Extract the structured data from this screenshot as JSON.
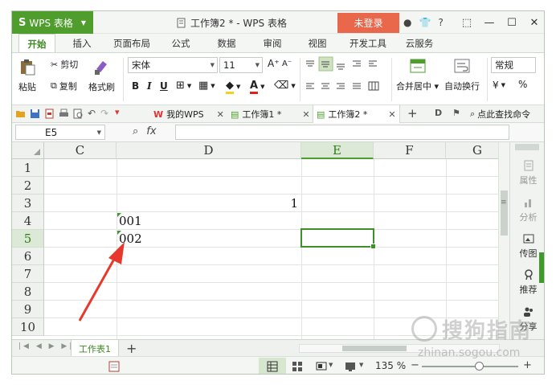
{
  "titlebar": {
    "app_name": "WPS 表格",
    "doc_title": "工作簿2 * - WPS 表格",
    "login_label": "未登录",
    "help_label": "?"
  },
  "ribbon_tabs": [
    "开始",
    "插入",
    "页面布局",
    "公式",
    "数据",
    "审阅",
    "视图",
    "开发工具",
    "云服务"
  ],
  "ribbon": {
    "paste": "粘贴",
    "cut": "剪切",
    "copy": "复制",
    "format_painter": "格式刷",
    "font_name": "宋体",
    "font_size": "11",
    "merge_center": "合并居中",
    "wrap_text": "自动换行",
    "number_format": "常规",
    "percent": "%"
  },
  "quickbar": {
    "my_wps": "我的WPS",
    "doc_tab_1": "工作簿1 *",
    "doc_tab_2": "工作簿2 *",
    "find_command": "点此查找命令"
  },
  "formula_bar": {
    "cell_ref": "E5",
    "formula_value": ""
  },
  "grid": {
    "columns": [
      "C",
      "D",
      "E",
      "F",
      "G"
    ],
    "selected_column": "E",
    "rows": [
      "1",
      "2",
      "3",
      "4",
      "5",
      "6",
      "7",
      "8",
      "9",
      "10"
    ],
    "selected_row": "5",
    "cells": {
      "D3": "1",
      "D4": "001",
      "D5": "002"
    }
  },
  "side_panel": {
    "attributes": "属性",
    "analysis": "分析",
    "upload_image": "传图",
    "recommend": "推荐",
    "share": "分享"
  },
  "sheets": {
    "active": "工作表1",
    "add": "+"
  },
  "status": {
    "zoom": "135 %"
  },
  "watermark": {
    "text": "搜狗指南",
    "url": "zhinan.sogou.com"
  },
  "colors": {
    "brand_green": "#4f9d2d",
    "login_orange": "#e9674a",
    "arrow_red": "#e8382c"
  }
}
